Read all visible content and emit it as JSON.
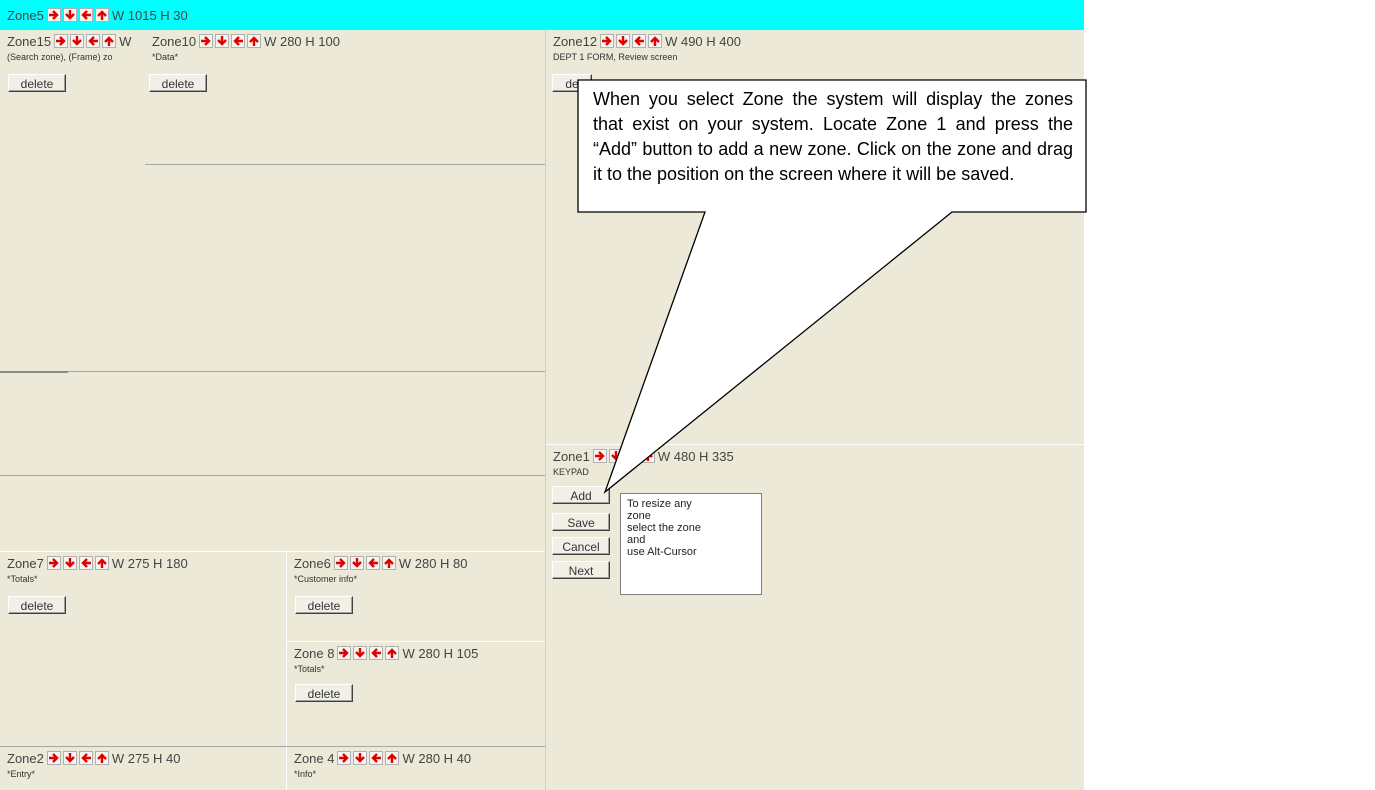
{
  "topbar": {
    "zone_label": "Zone5",
    "dims": "W 1015 H 30"
  },
  "zones": {
    "z15": {
      "title": "Zone15",
      "dims": "W",
      "sub": "(Search zone), (Frame) zo",
      "button": "delete"
    },
    "z10": {
      "title": "Zone10",
      "dims": "W 280 H 100",
      "sub": "*Data*",
      "button": "delete"
    },
    "z12": {
      "title": "Zone12",
      "dims": "W 490 H 400",
      "sub": "DEPT 1 FORM, Review screen",
      "button": "de"
    },
    "z1": {
      "title": "Zone1",
      "dims": "W 480 H 335",
      "sub": "KEYPAD"
    },
    "z7": {
      "title": "Zone7",
      "dims": "W 275 H 180",
      "sub": "*Totals*",
      "button": "delete"
    },
    "z6": {
      "title": "Zone6",
      "dims": "W 280 H 80",
      "sub": "*Customer info*",
      "button": "delete"
    },
    "z8": {
      "title": "Zone 8",
      "dims": "W 280 H 105",
      "sub": "*Totals*",
      "button": "delete"
    },
    "z2": {
      "title": "Zone2",
      "dims": "W 275 H 40",
      "sub": "*Entry*"
    },
    "z4": {
      "title": "Zone 4",
      "dims": "W 280 H 40",
      "sub": "*Info*"
    }
  },
  "side_buttons": {
    "add": "Add",
    "save": "Save",
    "cancel": "Cancel",
    "next": "Next"
  },
  "resize_note": [
    "To resize any",
    "zone",
    "select the zone",
    "and",
    "use Alt-Cursor"
  ],
  "callout": "When you select Zone the system will display the zones that exist on your system. Locate Zone 1 and press the “Add” button to add a new zone. Click on the zone and drag it to the position on the screen where it will be saved.",
  "colors": {
    "topbar": "#00ffff",
    "canvas": "#ece9d8",
    "arrow": "#e00000"
  },
  "icons": [
    "arrow-right-icon",
    "arrow-down-icon",
    "arrow-left-icon",
    "arrow-up-icon"
  ]
}
